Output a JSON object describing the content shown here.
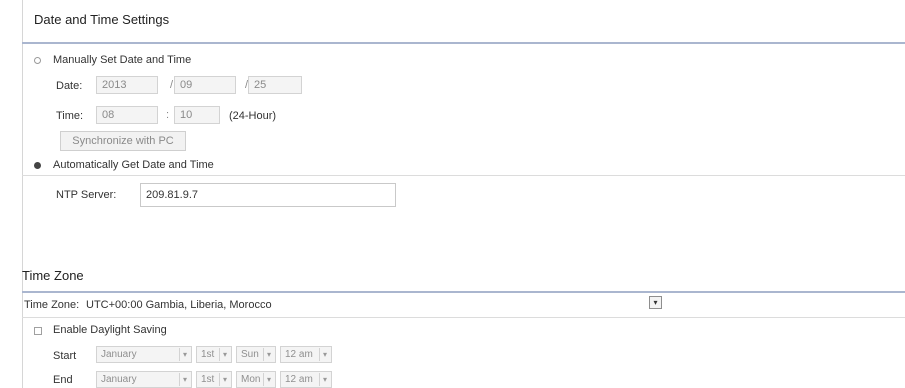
{
  "date_time": {
    "title": "Date and Time Settings",
    "manual_label": "Manually Set Date and Time",
    "date_label": "Date:",
    "year": "2013",
    "month": "09",
    "day": "25",
    "slash": "/",
    "time_label": "Time:",
    "hour": "08",
    "minute": "10",
    "colon": ":",
    "time_format": "(24-Hour)",
    "sync_button": "Synchronize with PC",
    "auto_label": "Automatically Get Date and Time",
    "ntp_label": "NTP Server:",
    "ntp_value": "209.81.9.7"
  },
  "time_zone": {
    "title": "Time Zone",
    "tz_label": "Time Zone:",
    "tz_value": "UTC+00:00 Gambia, Liberia, Morocco",
    "dst_label": "Enable Daylight Saving",
    "start_label": "Start",
    "end_label": "End",
    "start": {
      "month": "January",
      "week": "1st",
      "day": "Sun",
      "hour": "12 am"
    },
    "end": {
      "month": "January",
      "week": "1st",
      "day": "Mon",
      "hour": "12 am"
    }
  }
}
